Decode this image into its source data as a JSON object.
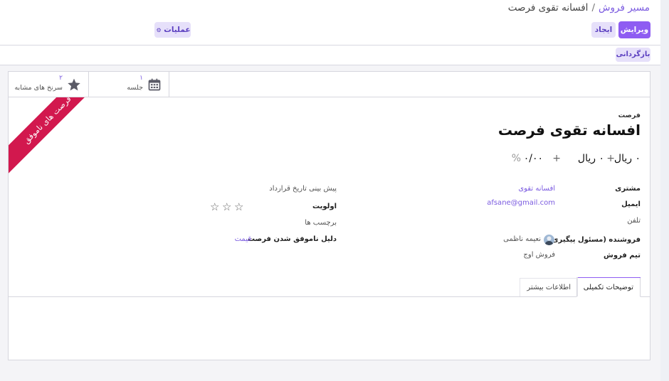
{
  "breadcrumb": {
    "parent": "مسیر فروش",
    "separator": "/",
    "current": "افسانه تقوی فرصت"
  },
  "toolbar": {
    "edit_label": "ویرایش",
    "create_label": "ایجاد",
    "actions_label": "عملیات"
  },
  "subbar": {
    "back_label": "بازگردانی"
  },
  "smart_buttons": [
    {
      "count": "۲",
      "label": "سرنخ های مشابه",
      "icon": "star-icon"
    },
    {
      "count": "۱",
      "label": "جلسه",
      "icon": "calendar-icon"
    }
  ],
  "ribbon": {
    "text": "فرصت های ناموفق",
    "color": "#d2184e"
  },
  "record": {
    "type_label": "فرصت",
    "title": "افسانه تقوی فرصت",
    "expected_revenue": "۰ ریال",
    "plus": "+",
    "recurring_revenue": "۰ ریال",
    "probability": "۰/۰۰",
    "percent_sign": "%"
  },
  "fields_right": [
    {
      "label": "مشتری",
      "value": "افسانه تقوی",
      "link": true
    },
    {
      "label": "ایمیل",
      "value": "afsane@gmail.com",
      "link": true
    },
    {
      "label": "تلفن",
      "value": "",
      "muted_label": true
    },
    {
      "label": "فروشنده (مسئول پیگیری)",
      "value": "نعیمه ناظمی",
      "avatar": true
    },
    {
      "label": "تیم فروش",
      "value": "فروش اوج"
    }
  ],
  "fields_left": [
    {
      "label": "پیش بینی تاریخ قرارداد",
      "value": ""
    },
    {
      "label": "اولویت",
      "value": "",
      "stars": 3
    },
    {
      "label": "برچسب ها",
      "value": ""
    },
    {
      "label": "دلیل ناموفق شدن فرصت",
      "value": "قیمت",
      "link": true
    }
  ],
  "tabs": [
    {
      "label": "توضیحات تکمیلی",
      "active": true
    },
    {
      "label": "اطلاعات بیشتر",
      "active": false
    }
  ],
  "colors": {
    "accent": "#8e5cf2",
    "link": "#7b5be0",
    "ribbon": "#d2184e"
  }
}
